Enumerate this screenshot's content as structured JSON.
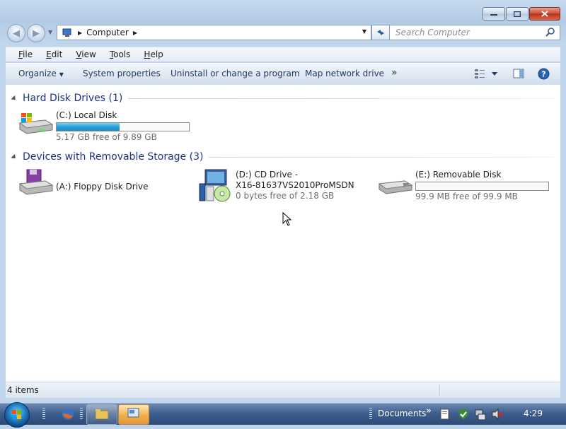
{
  "window": {
    "address": {
      "location": "Computer"
    },
    "search": {
      "placeholder": "Search Computer"
    }
  },
  "menu": {
    "items": [
      {
        "label": "File",
        "accel": "F",
        "rest": "ile"
      },
      {
        "label": "Edit",
        "accel": "E",
        "rest": "dit"
      },
      {
        "label": "View",
        "accel": "V",
        "rest": "iew"
      },
      {
        "label": "Tools",
        "accel": "T",
        "rest": "ools"
      },
      {
        "label": "Help",
        "accel": "H",
        "rest": "elp"
      }
    ]
  },
  "commandbar": {
    "organize": "Organize",
    "system_properties": "System properties",
    "uninstall": "Uninstall or change a program",
    "map_drive": "Map network drive",
    "more": "»"
  },
  "groups": {
    "hdd": {
      "title": "Hard Disk Drives (1)"
    },
    "removable": {
      "title": "Devices with Removable Storage (3)"
    }
  },
  "drives": {
    "c": {
      "name": "(C:) Local Disk",
      "free": "5.17 GB free of 9.89 GB",
      "used_fraction": 0.477
    },
    "a": {
      "name": "(A:) Floppy Disk Drive"
    },
    "d": {
      "name_line1": "(D:) CD Drive -",
      "name_line2": "X16-81637VS2010ProMSDN",
      "free": "0 bytes free of 2.18 GB"
    },
    "e": {
      "name": "(E:) Removable Disk",
      "free": "99.9 MB free of 99.9 MB",
      "used_fraction": 0.0
    }
  },
  "statusbar": {
    "count": "4 items"
  },
  "taskbar": {
    "documents": "Documents",
    "clock": "4:29"
  },
  "colors": {
    "group_title": "#1e3287",
    "bar_fill": "#26a0da",
    "secondary_text": "#6d6d6d"
  }
}
